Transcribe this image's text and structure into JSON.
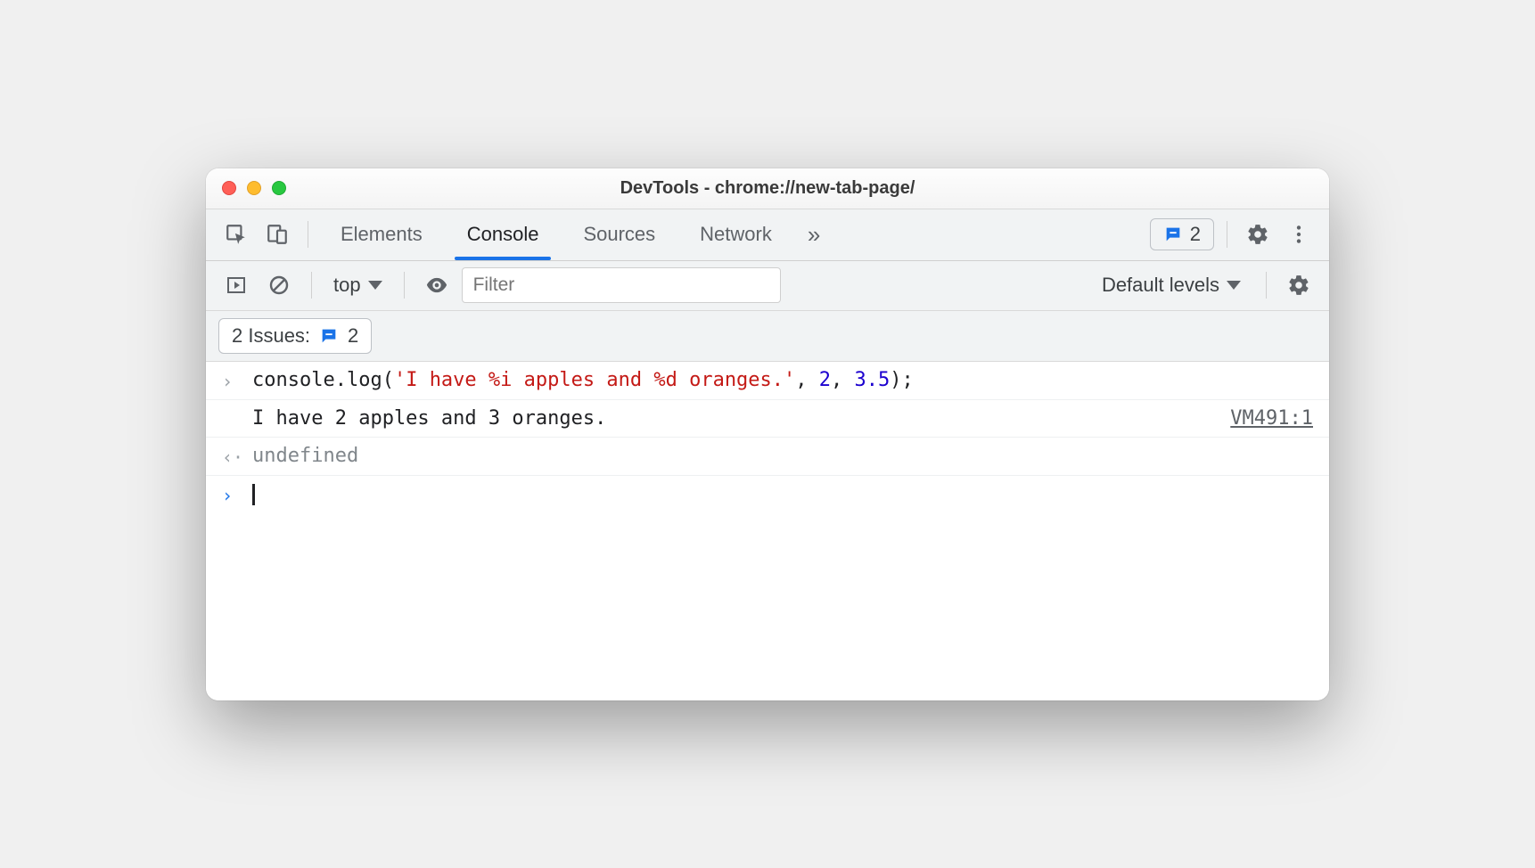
{
  "window": {
    "title": "DevTools - chrome://new-tab-page/"
  },
  "tabs": {
    "items": [
      "Elements",
      "Console",
      "Sources",
      "Network"
    ],
    "active": "Console"
  },
  "badge": {
    "count": "2"
  },
  "toolbar": {
    "context": "top",
    "filter_placeholder": "Filter",
    "levels": "Default levels"
  },
  "issues": {
    "label": "2 Issues:",
    "count": "2"
  },
  "console": {
    "input": {
      "prefix": "console.log(",
      "string": "'I have %i apples and %d oranges.'",
      "sep1": ", ",
      "arg1": "2",
      "sep2": ", ",
      "arg2": "3.5",
      "suffix": ");"
    },
    "output": {
      "text": "I have 2 apples and 3 oranges.",
      "source": "VM491:1"
    },
    "return": "undefined"
  }
}
